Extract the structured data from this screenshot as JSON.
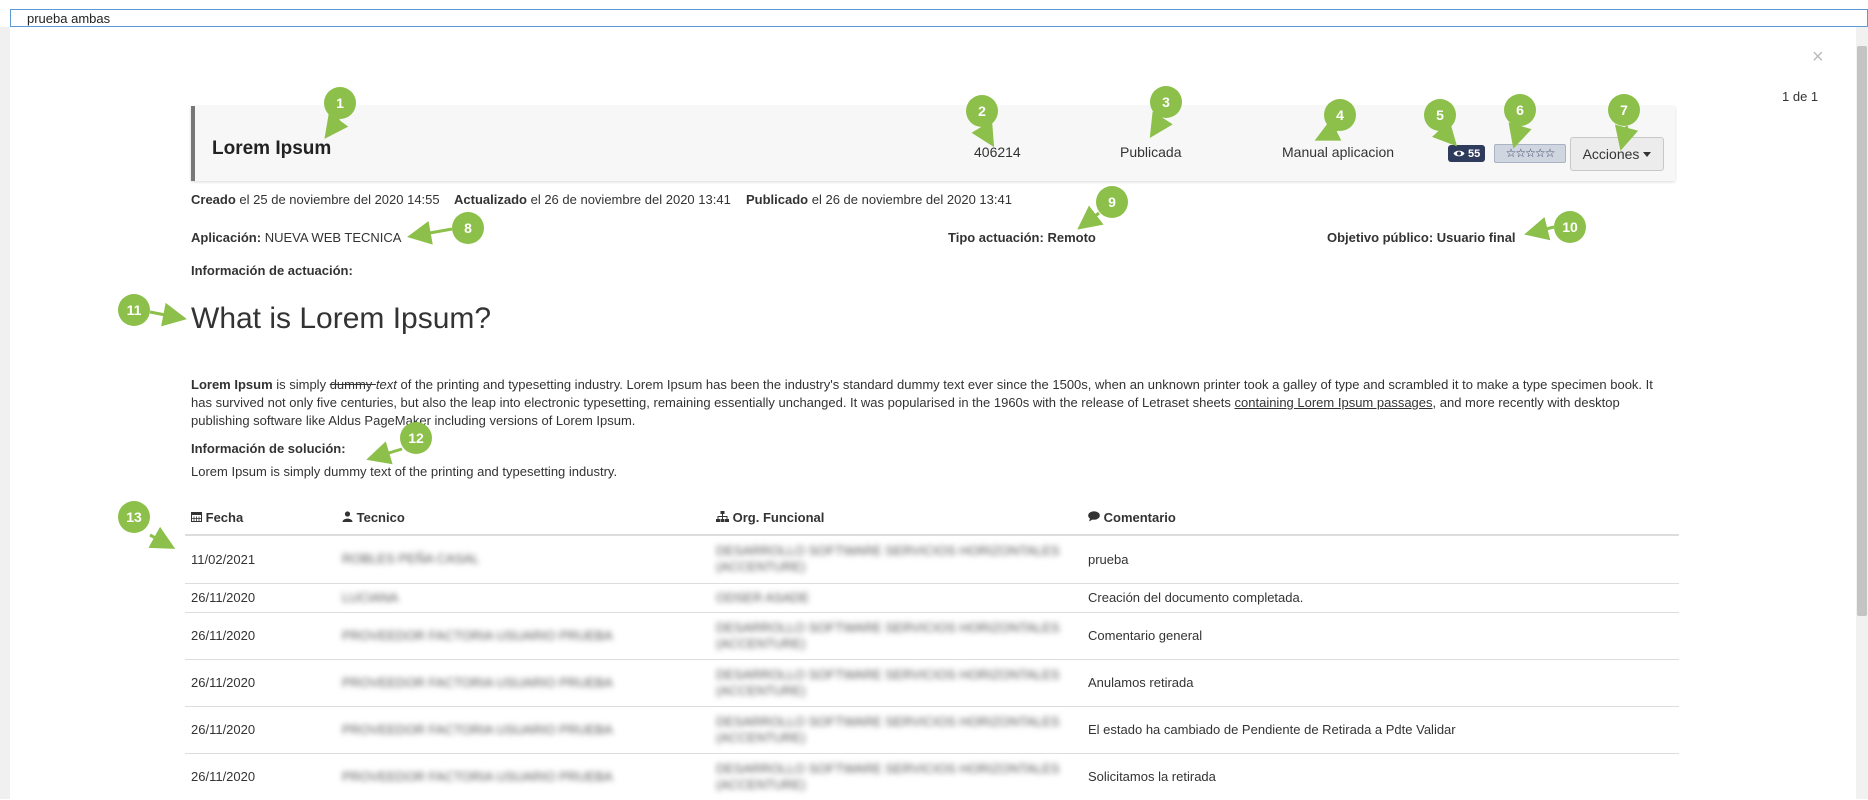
{
  "window": {
    "title": "prueba ambas",
    "pager": "1 de 1",
    "close": "×"
  },
  "header": {
    "title": "Lorem Ipsum",
    "id": "406214",
    "status": "Publicada",
    "type": "Manual aplicacion",
    "views": "55",
    "stars": "☆☆☆☆☆",
    "actions_label": "Acciones"
  },
  "meta": {
    "created_label": "Creado",
    "created_value": "el 25 de noviembre del 2020 14:55",
    "updated_label": "Actualizado",
    "updated_value": "el 26 de noviembre del 2020 13:41",
    "published_label": "Publicado",
    "published_value": "el 26 de noviembre del 2020 13:41"
  },
  "fields": {
    "app_label": "Aplicación:",
    "app_value": "NUEVA WEB TECNICA",
    "tipo_label": "Tipo actuación:",
    "tipo_value": "Remoto",
    "objetivo_label": "Objetivo público:",
    "objetivo_value": "Usuario final",
    "info_actuacion_label": "Información de actuación:"
  },
  "content": {
    "heading": "What is Lorem Ipsum?",
    "p_bold": "Lorem Ipsum",
    "p_1": " is simply ",
    "p_strike": "dummy ",
    "p_italic": "text",
    "p_2": " of the printing and typesetting industry. Lorem Ipsum has been the industry's standard dummy text ever since the 1500s, when an unknown printer took a galley of type and scrambled it to make a type specimen book. It has survived not only five centuries, but also the leap into electronic typesetting, remaining essentially unchanged. It was popularised in the 1960s with the release of Letraset sheets ",
    "p_link": "containing Lorem Ipsum passages",
    "p_3": ", and more recently with desktop publishing software like Aldus PageMaker including versions of Lorem Ipsum.",
    "solucion_label": "Información de solución:",
    "solucion_text": "Lorem Ipsum is simply dummy text of the printing and typesetting industry."
  },
  "table": {
    "headers": [
      "Fecha",
      "Tecnico",
      "Org. Funcional",
      "Comentario"
    ],
    "rows": [
      {
        "fecha": "11/02/2021",
        "tecnico": "ROBLES PEÑA CASAL",
        "org": "DESARROLLO SOFTWARE SERVICIOS HORIZONTALES (ACCENTURE)",
        "comentario": "prueba"
      },
      {
        "fecha": "26/11/2020",
        "tecnico": "LUCIANA",
        "org": "ODSER ASADE",
        "comentario": "Creación del documento completada."
      },
      {
        "fecha": "26/11/2020",
        "tecnico": "PROVEEDOR FACTORIA USUARIO PRUEBA",
        "org": "DESARROLLO SOFTWARE SERVICIOS HORIZONTALES (ACCENTURE)",
        "comentario": "Comentario general"
      },
      {
        "fecha": "26/11/2020",
        "tecnico": "PROVEEDOR FACTORIA USUARIO PRUEBA",
        "org": "DESARROLLO SOFTWARE SERVICIOS HORIZONTALES (ACCENTURE)",
        "comentario": "Anulamos retirada"
      },
      {
        "fecha": "26/11/2020",
        "tecnico": "PROVEEDOR FACTORIA USUARIO PRUEBA",
        "org": "DESARROLLO SOFTWARE SERVICIOS HORIZONTALES (ACCENTURE)",
        "comentario": "El estado ha cambiado de Pendiente de Retirada a Pdte Validar"
      },
      {
        "fecha": "26/11/2020",
        "tecnico": "PROVEEDOR FACTORIA USUARIO PRUEBA",
        "org": "DESARROLLO SOFTWARE SERVICIOS HORIZONTALES (ACCENTURE)",
        "comentario": "Solicitamos la retirada"
      }
    ]
  },
  "callouts": [
    "1",
    "2",
    "3",
    "4",
    "5",
    "6",
    "7",
    "8",
    "9",
    "10",
    "11",
    "12",
    "13"
  ],
  "colors": {
    "callout": "#8cc04a",
    "badge": "#2e3b5c",
    "header_border": "#777777"
  },
  "icons": {
    "views": "eye-icon",
    "actions": "caret-down-icon",
    "fecha": "calendar-icon",
    "tecnico": "user-icon",
    "org": "sitemap-icon",
    "comentario": "comment-icon",
    "close": "close-icon"
  }
}
